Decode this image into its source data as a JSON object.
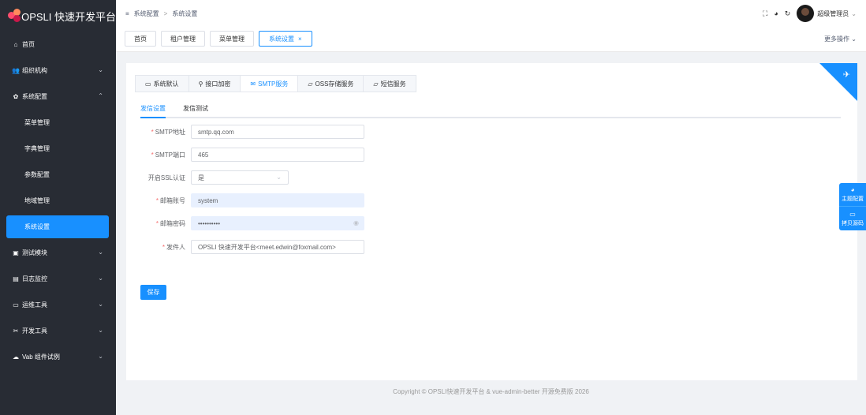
{
  "app": {
    "title": "OPSLI 快速开发平台"
  },
  "sidebar": {
    "items": [
      {
        "label": "首页",
        "icon": "home-icon",
        "glyph": "⌂"
      },
      {
        "label": "组织机构",
        "icon": "users-icon",
        "glyph": "👥",
        "chevron": "⌄"
      },
      {
        "label": "系统配置",
        "icon": "gear-icon",
        "glyph": "✿",
        "chevron": "⌃"
      },
      {
        "label": "菜单管理",
        "sub": true
      },
      {
        "label": "字典管理",
        "sub": true
      },
      {
        "label": "参数配置",
        "sub": true
      },
      {
        "label": "地域管理",
        "sub": true
      },
      {
        "label": "系统设置",
        "sub": true,
        "active": true
      },
      {
        "label": "测试模块",
        "icon": "briefcase-icon",
        "glyph": "▣",
        "chevron": "⌄"
      },
      {
        "label": "日志监控",
        "icon": "book-icon",
        "glyph": "▤",
        "chevron": "⌄"
      },
      {
        "label": "运维工具",
        "icon": "laptop-icon",
        "glyph": "▭",
        "chevron": "⌄"
      },
      {
        "label": "开发工具",
        "icon": "tools-icon",
        "glyph": "✂",
        "chevron": "⌄"
      },
      {
        "label": "Vab 组件试例",
        "icon": "chat-icon",
        "glyph": "☁",
        "chevron": "⌄"
      }
    ]
  },
  "header": {
    "menu_glyph": "≡",
    "breadcrumb": [
      "系统配置",
      "系统设置"
    ],
    "breadcrumb_sep": ">",
    "user_name": "超级管理员",
    "user_chev": "⌄",
    "icons": {
      "fullscreen": "⛶",
      "theme": "◕",
      "refresh": "↻"
    }
  },
  "tabs_bar": {
    "tabs": [
      {
        "label": "首页"
      },
      {
        "label": "租户管理"
      },
      {
        "label": "菜单管理"
      },
      {
        "label": "系统设置",
        "active": true,
        "close": "×"
      }
    ],
    "more": "更多操作 ⌄"
  },
  "content": {
    "corner_glyph": "✈",
    "card_tabs": [
      {
        "label": "系统默认",
        "glyph": "▭"
      },
      {
        "label": "接口加密",
        "glyph": "⚲"
      },
      {
        "label": "SMTP服务",
        "glyph": "✉",
        "active": true
      },
      {
        "label": "OSS存储服务",
        "glyph": "▱"
      },
      {
        "label": "短信服务",
        "glyph": "▱"
      }
    ],
    "sub_tabs": [
      {
        "label": "发信设置",
        "active": true
      },
      {
        "label": "发信测试"
      }
    ],
    "form": {
      "smtp_host": {
        "label": "SMTP地址",
        "value": "smtp.qq.com"
      },
      "smtp_port": {
        "label": "SMTP端口",
        "value": "465"
      },
      "ssl": {
        "label": "开启SSL认证",
        "value": "是",
        "arrow": "⌄"
      },
      "account": {
        "label": "邮箱账号",
        "value": "system"
      },
      "password": {
        "label": "邮箱密码",
        "value": "••••••••••",
        "eye": "◉"
      },
      "sender": {
        "label": "发件人",
        "value": "OPSLI 快速开发平台<meet.edwin@foxmail.com>"
      },
      "required_mark": "*"
    },
    "save_label": "保存"
  },
  "footer": {
    "text": "Copyright © OPSLI快速开发平台 & vue-admin-better 开源免费版 2026"
  },
  "float_panel": {
    "theme": {
      "label": "主题配置",
      "glyph": "◕"
    },
    "copy": {
      "label": "拷贝源码",
      "glyph": "▭"
    }
  },
  "colors": {
    "primary": "#1890ff",
    "sidebar_bg": "#282c34",
    "danger": "#f56c6c"
  }
}
